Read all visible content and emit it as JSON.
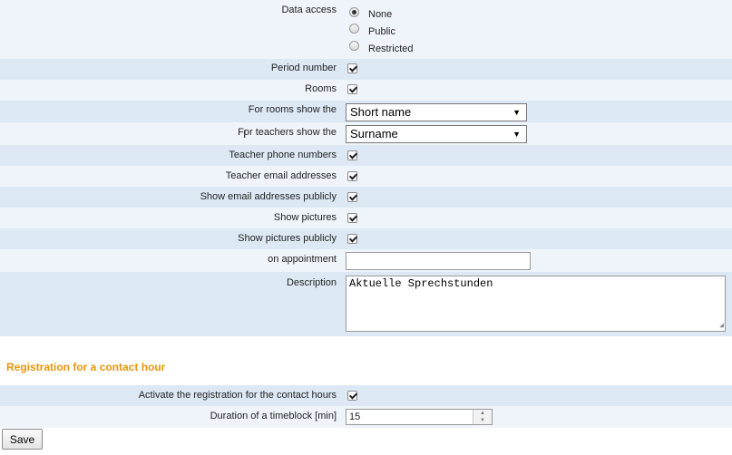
{
  "form": {
    "data_access": {
      "label": "Data access",
      "options": [
        "None",
        "Public",
        "Restricted"
      ],
      "selected": "None"
    },
    "period_number": {
      "label": "Period number",
      "checked": true
    },
    "rooms": {
      "label": "Rooms",
      "checked": true
    },
    "for_rooms": {
      "label": "For rooms show the",
      "value": "Short name"
    },
    "for_teachers": {
      "label": "For teachers show the",
      "value": "Surname"
    },
    "teacher_phone": {
      "label": "Teacher phone numbers",
      "checked": true
    },
    "teacher_email": {
      "label": "Teacher email addresses",
      "checked": true
    },
    "email_public": {
      "label": "Show email addresses publicly",
      "checked": true
    },
    "show_pictures": {
      "label": "Show pictures",
      "checked": true
    },
    "pictures_public": {
      "label": "Show pictures publicly",
      "checked": true
    },
    "on_appointment": {
      "label": "on appointment",
      "value": ""
    },
    "description": {
      "label": "Description",
      "value": "Aktuelle Sprechstunden"
    }
  },
  "registration": {
    "title": "Registration for a contact hour",
    "activate": {
      "label": "Activate the registration for the contact hours",
      "checked": true
    },
    "duration": {
      "label": "Duration of a timeblock [min]",
      "value": "15"
    }
  },
  "save_label": "Save"
}
